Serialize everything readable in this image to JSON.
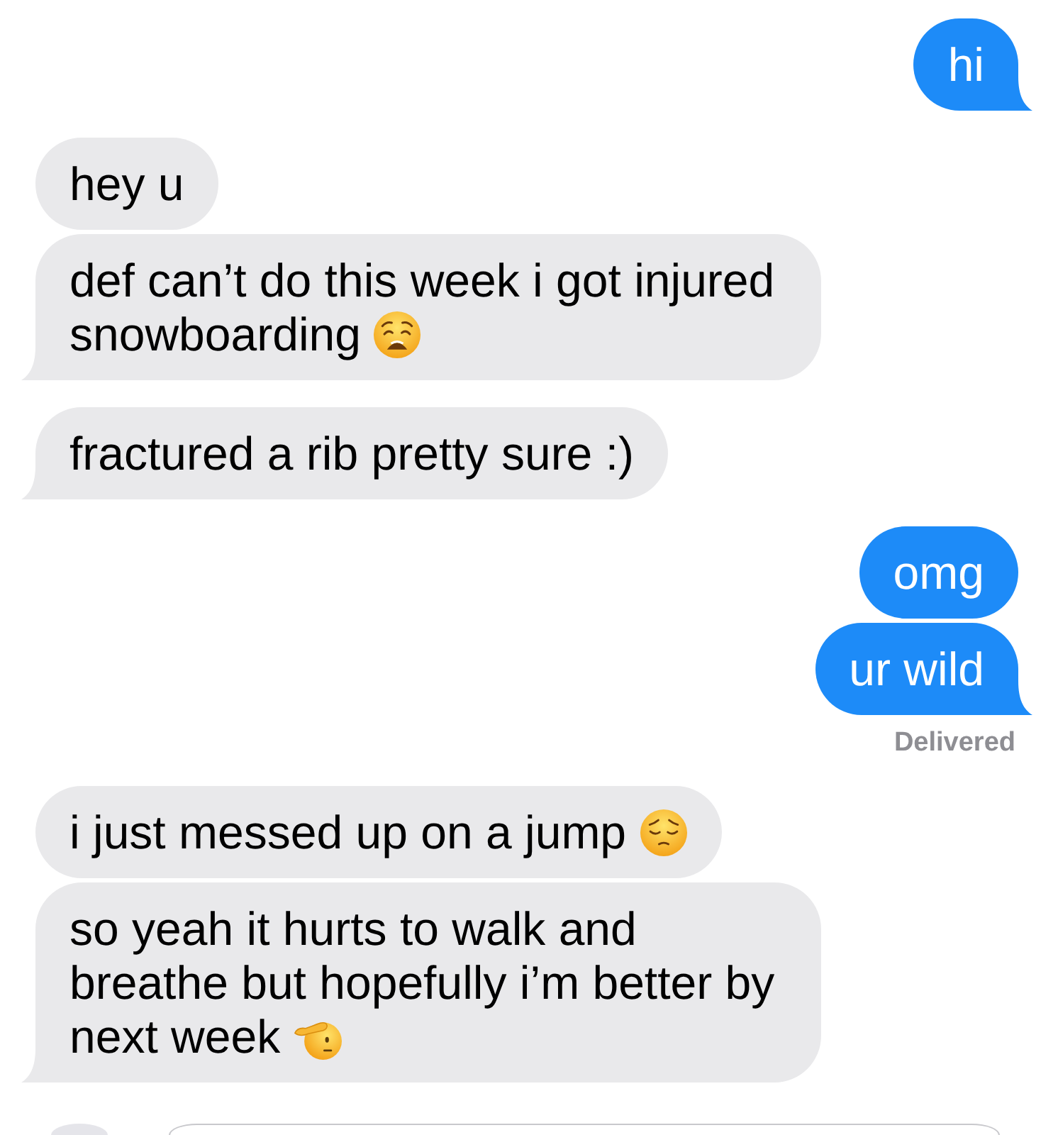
{
  "conversation": {
    "groups": [
      {
        "kind": "sent",
        "messages": [
          {
            "text": "hi"
          }
        ]
      },
      {
        "kind": "received",
        "messages": [
          {
            "text": "hey u"
          },
          {
            "text": "def can’t do this week i got injured snowboarding",
            "emoji": {
              "kind": "weary"
            }
          }
        ]
      },
      {
        "kind": "received",
        "messages": [
          {
            "text": "fractured a rib pretty sure :)"
          }
        ]
      },
      {
        "kind": "sent",
        "messages": [
          {
            "text": "omg"
          },
          {
            "text": "ur wild"
          }
        ],
        "status": "Delivered"
      },
      {
        "kind": "received",
        "messages": [
          {
            "text": "i just messed up on a jump",
            "emoji": {
              "kind": "pensive"
            }
          },
          {
            "text": "so yeah it hurts to walk and breathe but hopefully i’m better by next week",
            "emoji": {
              "kind": "salute"
            }
          }
        ]
      }
    ]
  }
}
